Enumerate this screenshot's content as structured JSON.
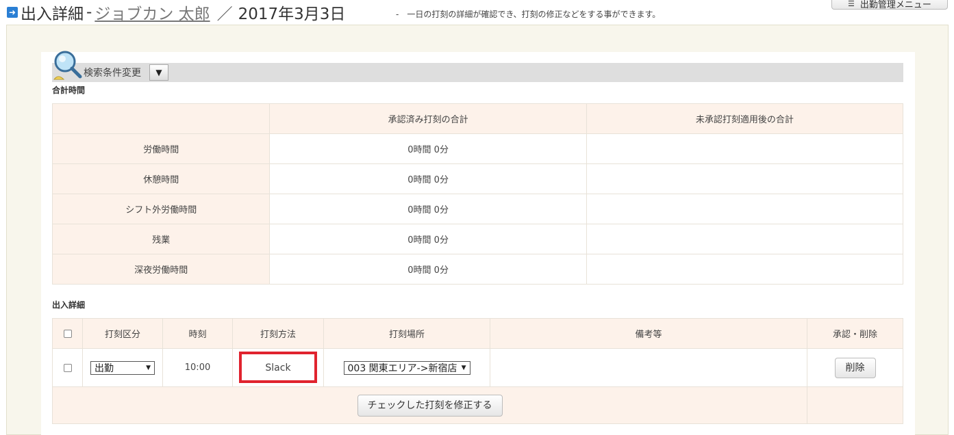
{
  "header": {
    "title": "出入詳細",
    "separator": "-",
    "user_name": "ジョブカン 太郎",
    "slash": "／",
    "date": "2017年3月3日",
    "description": "-　一日の打刻の詳細が確認でき、打刻の修正などをする事ができます。",
    "menu_button": "出勤管理メニュー"
  },
  "search": {
    "label": "検索条件変更",
    "toggle": "▼"
  },
  "summary": {
    "section_title": "合計時間",
    "columns": [
      "",
      "承認済み打刻の合計",
      "未承認打刻適用後の合計"
    ],
    "rows": [
      {
        "label": "労働時間",
        "approved": "0時間 0分",
        "unapproved": ""
      },
      {
        "label": "休憩時間",
        "approved": "0時間 0分",
        "unapproved": ""
      },
      {
        "label": "シフト外労働時間",
        "approved": "0時間 0分",
        "unapproved": ""
      },
      {
        "label": "残業",
        "approved": "0時間 0分",
        "unapproved": ""
      },
      {
        "label": "深夜労働時間",
        "approved": "0時間 0分",
        "unapproved": ""
      }
    ]
  },
  "detail": {
    "section_title": "出入詳細",
    "columns": {
      "type": "打刻区分",
      "time": "時刻",
      "method": "打刻方法",
      "place": "打刻場所",
      "note": "備考等",
      "action": "承認・削除"
    },
    "rows": [
      {
        "type": "出勤",
        "time": "10:00",
        "method": "Slack",
        "place": "003 関東エリア->新宿店",
        "note": "",
        "action": "削除"
      }
    ],
    "fix_button": "チェックした打刻を修正する"
  },
  "colors": {
    "highlight_border": "#e0232e",
    "table_header_bg": "#fdf2ea",
    "panel_bg": "#f8f6ec"
  }
}
